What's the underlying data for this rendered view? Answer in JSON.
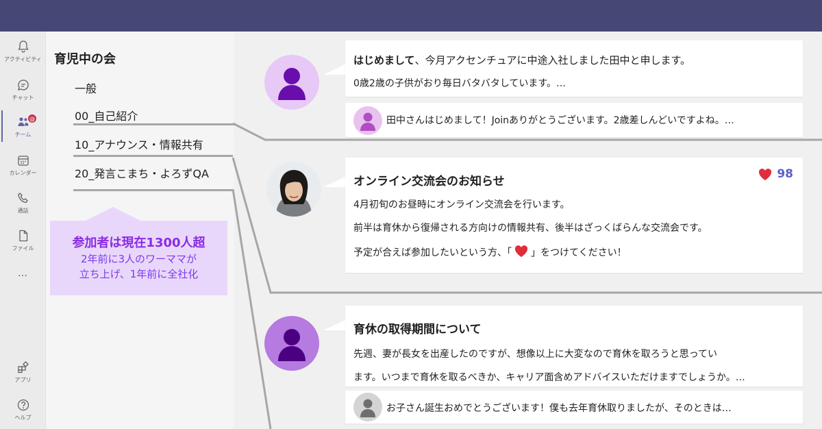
{
  "rail": {
    "items": [
      {
        "label": "アクティビティ",
        "icon": "bell-icon"
      },
      {
        "label": "チャット",
        "icon": "chat-icon"
      },
      {
        "label": "チーム",
        "icon": "teams-icon"
      },
      {
        "label": "カレンダー",
        "icon": "calendar-icon"
      },
      {
        "label": "通話",
        "icon": "phone-icon"
      },
      {
        "label": "ファイル",
        "icon": "file-icon"
      },
      {
        "label": "アプリ",
        "icon": "apps-icon"
      },
      {
        "label": "ヘルプ",
        "icon": "help-icon"
      }
    ],
    "more": "…",
    "badge": "@"
  },
  "team": {
    "name": "育児中の会",
    "channels": [
      "一般",
      "00_自己紹介",
      "10_アナウンス・情報共有",
      "20_発言こまち・よろずQA"
    ]
  },
  "callout": {
    "headline": "参加者は現在1300人超",
    "line1": "2年前に3人のワーママが",
    "line2": "立ち上げ、1年前に全社化"
  },
  "posts": {
    "p1": {
      "title": "はじめまして",
      "title_rest": "、今月アクセンチュアに中途入社しました田中と申します。",
      "line": "0歳2歳の子供がおり毎日バタバタしています。…",
      "reply": "田中さんはじめまして！Joinありがとうございます。2歳差しんどいですよね。…"
    },
    "p2": {
      "title": "オンライン交流会のお知らせ",
      "likes": "98",
      "line1": "4月初旬のお昼時にオンライン交流会を行います。",
      "line2": "前半は育休から復帰される方向けの情報共有、後半はざっくばらんな交流会です。",
      "line3_pre": "予定が合えば参加したいという方、「",
      "line3_post": "」をつけてください！"
    },
    "p3": {
      "title": "育休の取得期間について",
      "line1": "先週、妻が長女を出産したのですが、想像以上に大変なので育休を取ろうと思ってい",
      "line2": "ます。いつまで育休を取るべきか、キャリア面含めアドバイスいただけますでしょうか。…",
      "reply": "お子さん誕生おめでとうございます！僕も去年育休取りましたが、そのときは…"
    }
  },
  "colors": {
    "topbar": "#464775",
    "accent": "#6264a7",
    "callout_bg": "#e9d7fb",
    "callout_text": "#8a2be2",
    "heart": "#e02d3c",
    "avatar1_bg": "#e7c8f7",
    "avatar1_fg": "#6a0dad",
    "avatar3_bg": "#b57be0",
    "avatar3_fg": "#4b0082"
  }
}
